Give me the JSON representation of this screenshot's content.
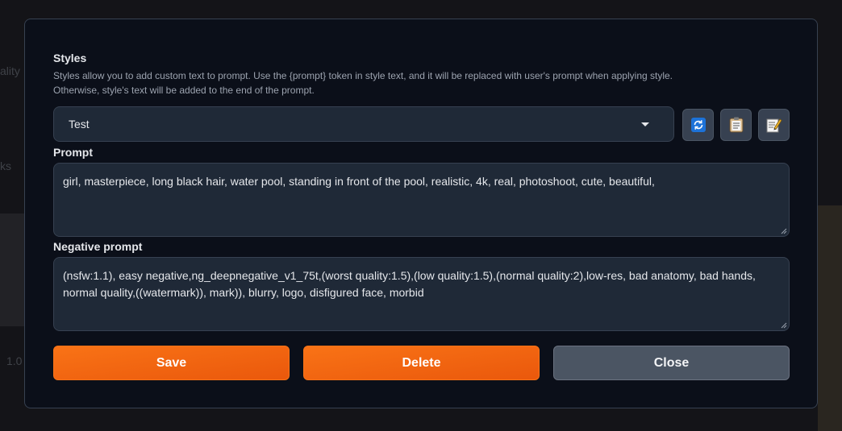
{
  "background": {
    "left_text_1": "ality",
    "left_text_2": "ks",
    "left_text_3": "1.0"
  },
  "modal": {
    "styles_title": "Styles",
    "styles_description": "Styles allow you to add custom text to prompt. Use the {prompt} token in style text, and it will be replaced with user's prompt when applying style. Otherwise, style's text will be added to the end of the prompt.",
    "selected_style": "Test",
    "tool_buttons": [
      {
        "icon": "refresh-icon"
      },
      {
        "icon": "clipboard-icon"
      },
      {
        "icon": "edit-note-icon"
      }
    ],
    "prompt_label": "Prompt",
    "prompt_value": "girl, masterpiece, long black hair, water pool, standing in front of the pool, realistic, 4k, real, photoshoot, cute, beautiful,",
    "negative_prompt_label": "Negative prompt",
    "negative_prompt_value": "(nsfw:1.1), easy negative,ng_deepnegative_v1_75t,(worst quality:1.5),(low quality:1.5),(normal quality:2),low-res, bad anatomy, bad hands, normal quality,((watermark)), mark)), blurry, logo, disfigured face, morbid",
    "buttons": {
      "save": "Save",
      "delete": "Delete",
      "close": "Close"
    }
  },
  "colors": {
    "accent": "#f97316",
    "modal_bg": "#0b0f19",
    "field_bg": "#1f2937"
  }
}
